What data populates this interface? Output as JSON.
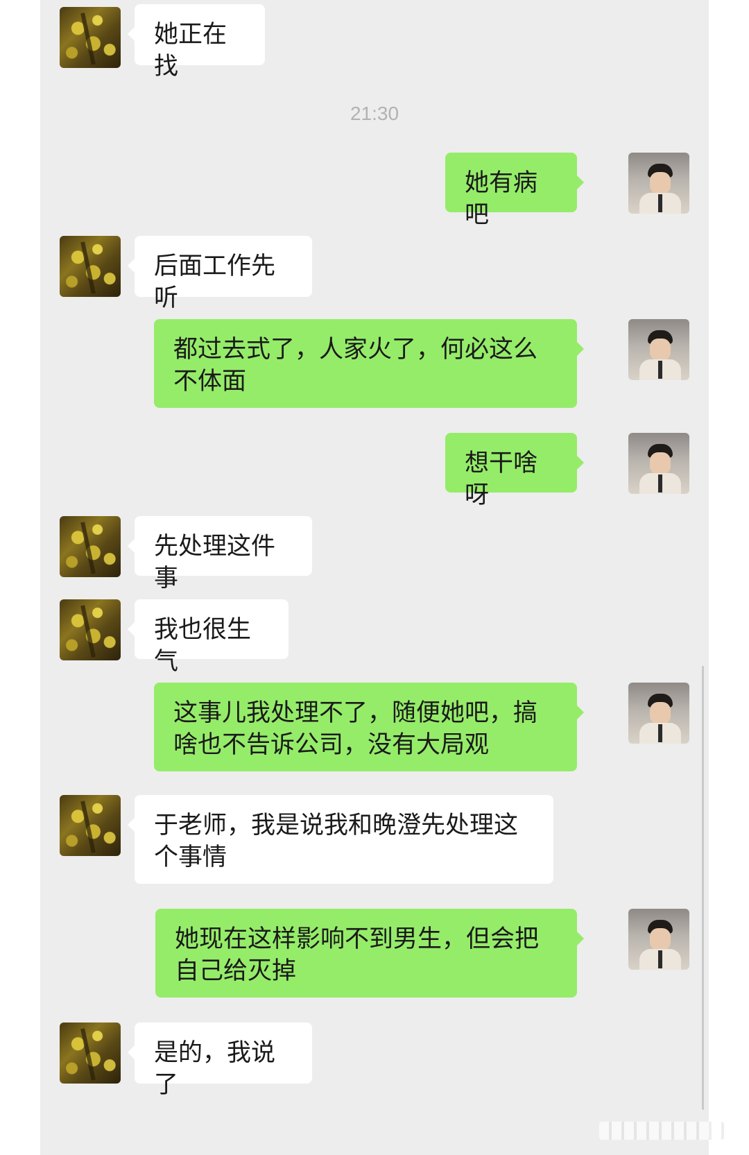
{
  "chat": {
    "timestamp": "21:30",
    "messages": [
      {
        "side": "left",
        "text": "她正在找"
      },
      {
        "side": "right",
        "text": "她有病吧"
      },
      {
        "side": "left",
        "text": "后面工作先听"
      },
      {
        "side": "right",
        "text": "都过去式了，人家火了，何必这么不体面"
      },
      {
        "side": "right",
        "text": "想干啥呀"
      },
      {
        "side": "left",
        "text": "先处理这件事"
      },
      {
        "side": "left",
        "text": "我也很生气"
      },
      {
        "side": "right",
        "text": "这事儿我处理不了，随便她吧，搞啥也不告诉公司，没有大局观"
      },
      {
        "side": "left",
        "text": "于老师，我是说我和晚澄先处理这个事情"
      },
      {
        "side": "right",
        "text": "她现在这样影响不到男生，但会把自己给灭掉"
      },
      {
        "side": "left",
        "text": "是的，我说了"
      }
    ]
  },
  "colors": {
    "panel_bg": "#ededed",
    "bubble_self": "#95ec69",
    "bubble_other": "#ffffff",
    "timestamp_text": "#b2b2b2"
  }
}
